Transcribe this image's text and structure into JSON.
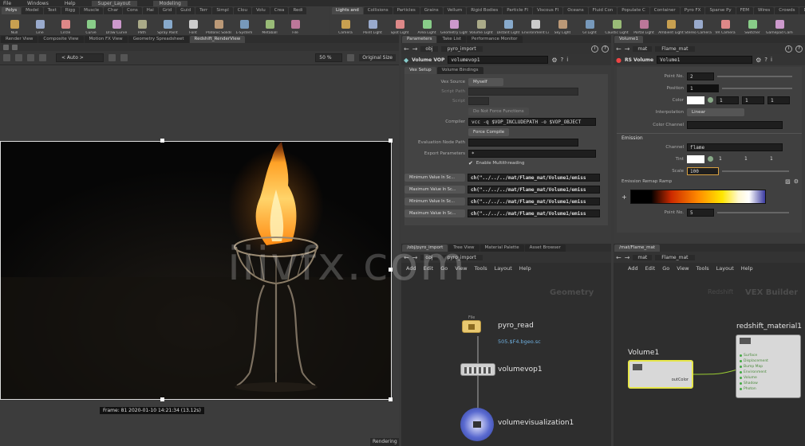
{
  "menubar": {
    "items": [
      "File",
      "Windows",
      "Help",
      "Super_Layout",
      "Modeling"
    ]
  },
  "shelf": {
    "left_tabs": [
      "Polys",
      "Model",
      "Text",
      "Rigg",
      "Muscle",
      "Char",
      "Cons",
      "Hai",
      "Grid",
      "Guid",
      "Terr",
      "Simpl",
      "Clou",
      "Volu",
      "Crea",
      "Redi"
    ],
    "right_tabs": [
      "Lights and",
      "Collisions",
      "Particles",
      "Grains",
      "Vellum",
      "Rigid Bodies",
      "Particle Fl",
      "Viscous Fl",
      "Oceans",
      "Fluid Con",
      "Populate C",
      "Container",
      "Pyro FX",
      "Sparse Py",
      "FEM",
      "Wires",
      "Crowds",
      "Drive Sim"
    ],
    "left_tools": [
      "Null",
      "Line",
      "Circle",
      "Curve",
      "Draw Curve",
      "Path",
      "Spray Paint",
      "Font",
      "Platonic Solids",
      "L-System",
      "Metaball",
      "File"
    ],
    "right_tools": [
      "Camera",
      "Point Light",
      "Spot Light",
      "Area Light",
      "Geometry Light",
      "Volume Light",
      "Distant Light",
      "Environment Light",
      "Sky Light",
      "GI Light",
      "Caustic Light",
      "Portal Light",
      "Ambient Light",
      "Stereo Camera",
      "VR Camera",
      "Switcher",
      "Gamepad Camera"
    ]
  },
  "viewer": {
    "tabs": [
      "Render View",
      "Composite View",
      "Motion FX View",
      "Geometry Spreadsheet",
      "Redshift_RenderView"
    ],
    "dropdown": "< Auto >",
    "zoom": "50 %",
    "size_button": "Original Size",
    "frame_info": "Frame: 81   2020-01-10  14:21:34  (13.12s)",
    "status": "Rendering"
  },
  "params_left": {
    "tabs": [
      "Parameters",
      "Take List",
      "Performance Monitor"
    ],
    "path": [
      "obj",
      "pyro_import"
    ],
    "node_type": "Volume VOP",
    "node_name": "volumevop1",
    "subtabs": [
      "Vex Setup",
      "Volume Bindings"
    ],
    "rows": [
      {
        "label": "Vex Source",
        "value": "Myself"
      },
      {
        "label": "Script Path",
        "value": ""
      },
      {
        "label": "Script",
        "value": ""
      }
    ],
    "recursive_button": "Do Not Force Functions",
    "compiler_label": "Compiler",
    "compiler_value": "vcc -q $VOP_INCLUDEPATH -o $VOP_OBJECT",
    "force_compile": "Force Compile",
    "eval_label": "Evaluation Node Path",
    "export_label": "Export Parameters",
    "export_value": "*",
    "multithread": "Enable Multithreading",
    "expr_rows": [
      {
        "label": "Minimum Value In Sc...",
        "value": "ch(\"../../../mat/Flame_mat/Volume1/emiss"
      },
      {
        "label": "Maximum Value In Sc...",
        "value": "ch(\"../../../mat/Flame_mat/Volume1/emiss"
      },
      {
        "label": "Minimum Value In Sc...",
        "value": "ch(\"../../../mat/Flame_mat/Volume1/emiss"
      },
      {
        "label": "Maximum Value In Sc...",
        "value": "ch(\"../../../mat/Flame_mat/Volume1/emiss"
      }
    ]
  },
  "params_right": {
    "tabs": [
      "Volume1"
    ],
    "path": [
      "mat",
      "Flame_mat"
    ],
    "node_type": "RS Volume",
    "node_name": "Volume1",
    "point_no_label": "Point No.",
    "point_no_value": "2",
    "position_label": "Position",
    "position_value": "1",
    "color_label": "Color",
    "color_values": [
      "1",
      "1",
      "1"
    ],
    "interp_label": "Interpolation",
    "interp_value": "Linear",
    "color_channel_label": "Color Channel",
    "emission_header": "Emission",
    "channel_label": "Channel",
    "channel_value": "flame",
    "tint_label": "Tint",
    "tint_values": [
      "1",
      "1",
      "1"
    ],
    "scale_label": "Scale",
    "scale_value": "100",
    "ramp_label": "Emission Remap Ramp",
    "ramp_point_label": "Point No.",
    "ramp_point_value": "5"
  },
  "network_left": {
    "tabs": [
      "/obj/pyro_import",
      "Tree View",
      "Material Palette",
      "Asset Browser"
    ],
    "path": [
      "obj",
      "pyro_import"
    ],
    "menu": [
      "Add",
      "Edit",
      "Go",
      "View",
      "Tools",
      "Layout",
      "Help"
    ],
    "context_label": "Geometry",
    "nodes": [
      {
        "title": "pyro_read",
        "sub": "505.$F4.bgeo.sc",
        "type": "File"
      },
      {
        "title": "volumevop1"
      },
      {
        "title": "volumevisualization1"
      }
    ]
  },
  "network_right": {
    "tabs": [
      "/mat/Flame_mat"
    ],
    "path": [
      "mat",
      "Flame_mat"
    ],
    "menu": [
      "Add",
      "Edit",
      "Go",
      "View",
      "Tools",
      "Layout",
      "Help"
    ],
    "context_label": "VEX Builder",
    "context_prefix": "Redshift",
    "nodes": [
      {
        "title": "Volume1",
        "output": "outColor"
      },
      {
        "title": "redshift_material1",
        "inputs": [
          "Surface",
          "Displacement",
          "Bump Map",
          "Environment",
          "Volume",
          "Shadow",
          "Photon"
        ]
      }
    ]
  },
  "watermark": "iiivfx.com"
}
